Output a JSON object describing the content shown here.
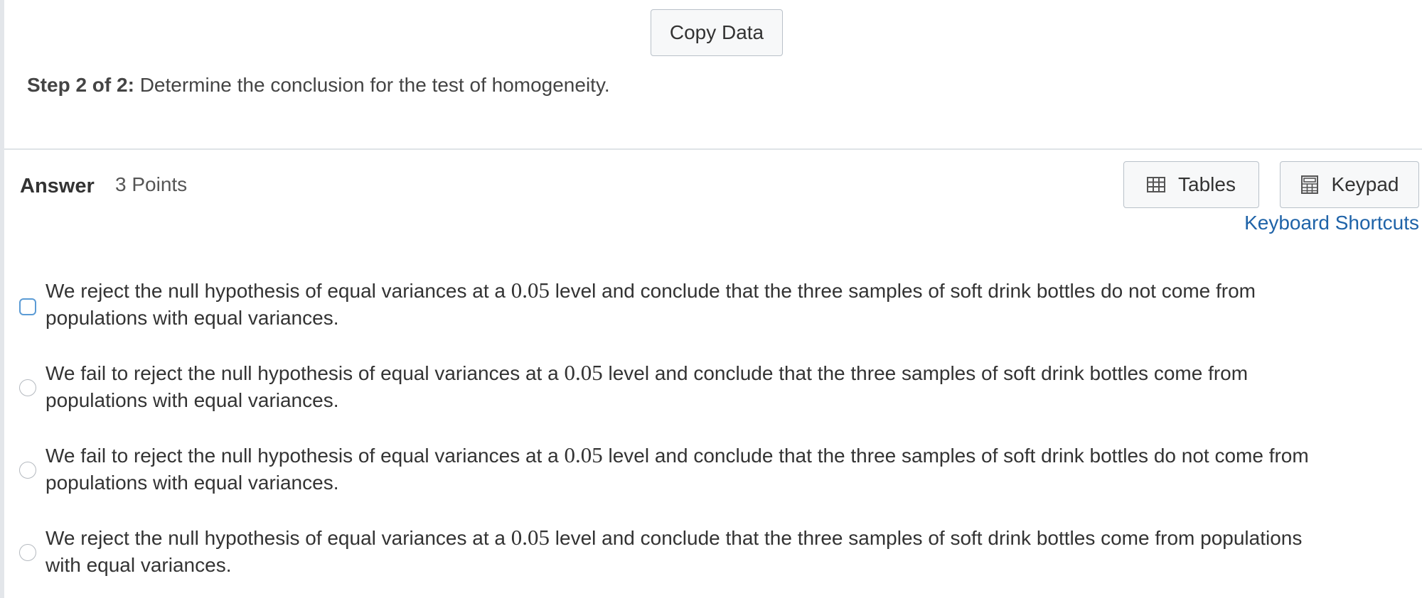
{
  "toolbar": {
    "copy_data_label": "Copy Data"
  },
  "step": {
    "label": "Step 2 of 2:",
    "text": " Determine the conclusion for the test of homogeneity."
  },
  "answer": {
    "label": "Answer",
    "points": "3 Points",
    "tables_label": "Tables",
    "keypad_label": "Keypad",
    "shortcuts_label": "Keyboard Shortcuts"
  },
  "icons": {
    "tables": "table-grid-icon",
    "keypad": "calculator-icon"
  },
  "colors": {
    "link": "#1f63a8",
    "focus_ring": "#5b9bd5"
  },
  "options": [
    {
      "before": "We reject the null hypothesis of equal variances at a ",
      "value": "0.05",
      "after_line1": " level and conclude that the three samples of soft drink bottles do not come from",
      "line2": "populations with equal variances.",
      "focused": true
    },
    {
      "before": "We fail to reject the null hypothesis of equal variances at a ",
      "value": "0.05",
      "after_line1": " level and conclude that the three samples of soft drink bottles come from",
      "line2": "populations with equal variances.",
      "focused": false
    },
    {
      "before": "We fail to reject the null hypothesis of equal variances at a ",
      "value": "0.05",
      "after_line1": " level and conclude that the three samples of soft drink bottles do not come from",
      "line2": "populations with equal variances.",
      "focused": false
    },
    {
      "before": "We reject the null hypothesis of equal variances at a ",
      "value": "0.05",
      "after_line1": " level and conclude that the three samples of soft drink bottles come from populations",
      "line2": "with equal variances.",
      "focused": false
    }
  ]
}
